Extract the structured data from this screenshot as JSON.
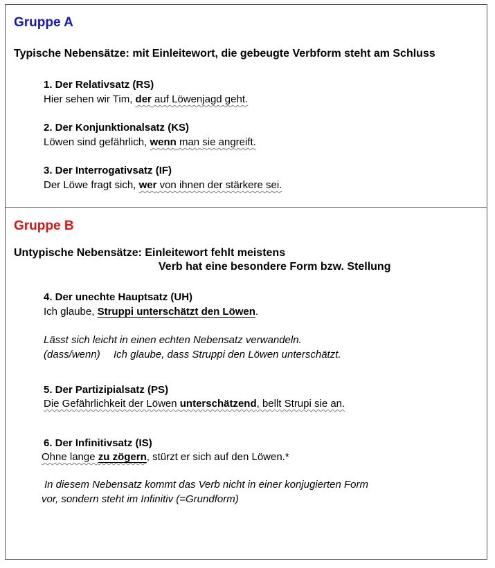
{
  "group_a": {
    "title": "Gruppe A",
    "heading": "Typische Nebensätze:  mit Einleitewort, die gebeugte Verbform steht am Schluss",
    "items": [
      {
        "title": "1. Der Relativsatz (RS)",
        "prefix": "Hier sehen wir Tim, ",
        "keyword": "der",
        "rest": " auf Löwenjagd geht."
      },
      {
        "title": "2. Der Konjunktionalsatz (KS)",
        "prefix": "Löwen sind gefährlich, ",
        "keyword": "wenn",
        "rest": " man sie angreift."
      },
      {
        "title": "3.  Der Interrogativsatz (IF)",
        "prefix": "Der Löwe fragt sich, ",
        "keyword": "wer",
        "rest": " von ihnen der stärkere sei."
      }
    ]
  },
  "group_b": {
    "title": "Gruppe B",
    "heading_line1": "Untypische Nebensätze:  Einleitewort fehlt meistens",
    "heading_line2": "Verb hat eine besondere Form bzw. Stellung",
    "item4": {
      "title": "4. Der unechte Hauptsatz (UH)",
      "prefix": "Ich glaube, ",
      "clause": "Struppi unterschätzt den Löwen",
      "suffix": ".",
      "note_line1": "Lässt sich leicht in einen echten Nebensatz verwandeln.",
      "note_label": "(dass/wenn)",
      "note_example": "Ich glaube, dass Struppi den Löwen unterschätzt."
    },
    "item5": {
      "title": "5. Der Partizipialsatz (PS)",
      "prefix": "Die Gefährlichkeit der Löwen ",
      "keyword": "unterschätzend",
      "rest": ", bellt Strupi sie an."
    },
    "item6": {
      "title": "6. Der Infinitivsatz (IS)",
      "prefix": "Ohne lange ",
      "keyword": "zu zögern",
      "rest": ", stürzt er sich auf den Löwen.*",
      "note_line1": "In diesem Nebensatz kommt das Verb nicht in einer konjugierten Form",
      "note_line2": "vor, sondern steht im Infinitiv (=Grundform)"
    }
  }
}
